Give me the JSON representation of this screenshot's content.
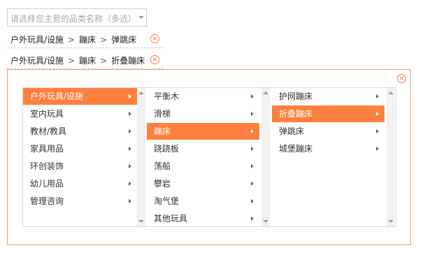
{
  "select": {
    "placeholder": "请选择您主营的品类名称（多选）"
  },
  "chosen": [
    {
      "l1": "户外玩具/设施",
      "l2": "蹦床",
      "l3": "弹跳床"
    },
    {
      "l1": "户外玩具/设施",
      "l2": "蹦床",
      "l3": "折叠蹦床"
    }
  ],
  "separator": ">",
  "remove_glyph": "×",
  "columns": {
    "level1": [
      "户外玩具/设施",
      "室内玩具",
      "教材/教具",
      "家具用品",
      "环创装饰",
      "幼儿用品",
      "管理咨询"
    ],
    "level2": [
      "平衡木",
      "滑梯",
      "蹦床",
      "跷跷板",
      "荡船",
      "攀岩",
      "淘气堡",
      "其他玩具"
    ],
    "level3": [
      "护网蹦床",
      "折叠蹦床",
      "弹跳床",
      "城堡蹦床"
    ]
  },
  "selected": {
    "level1": "户外玩具/设施",
    "level2": "蹦床",
    "level3": "折叠蹦床"
  },
  "colors": {
    "accent": "#ff7f3e",
    "remove_icon": "#ff7a45",
    "panel_border": "#f0a070"
  }
}
